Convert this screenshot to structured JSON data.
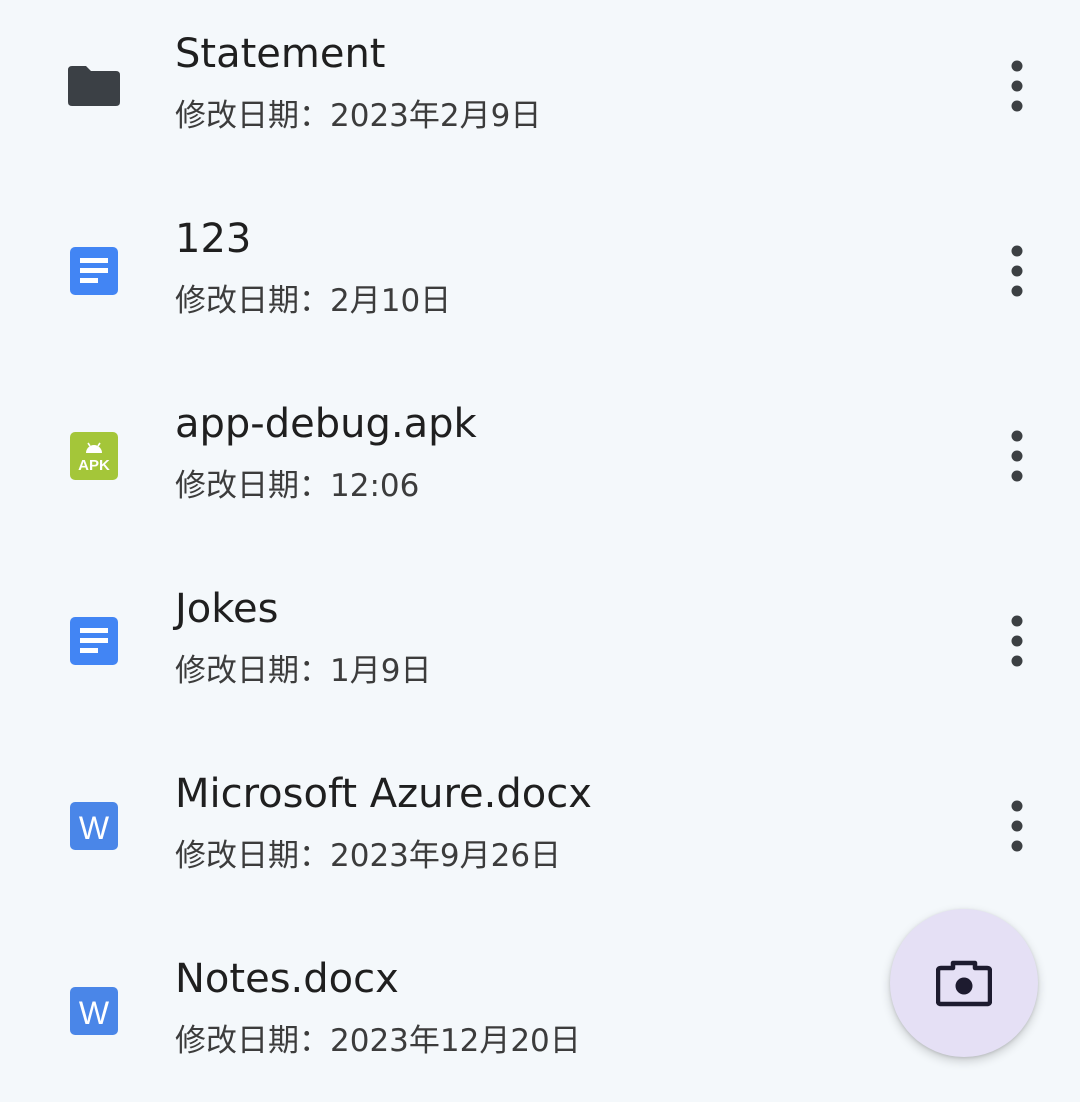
{
  "files": [
    {
      "name": "Statement",
      "modified": "修改日期：2023年2月9日",
      "icon": "folder-icon"
    },
    {
      "name": "123",
      "modified": "修改日期：2月10日",
      "icon": "google-doc-icon"
    },
    {
      "name": "app-debug.apk",
      "modified": "修改日期：12:06",
      "icon": "apk-icon",
      "icon_text": "APK"
    },
    {
      "name": "Jokes",
      "modified": "修改日期：1月9日",
      "icon": "google-doc-icon"
    },
    {
      "name": "Microsoft Azure.docx",
      "modified": "修改日期：2023年9月26日",
      "icon": "word-doc-icon",
      "icon_text": "W"
    },
    {
      "name": "Notes.docx",
      "modified": "修改日期：2023年12月20日",
      "icon": "word-doc-icon",
      "icon_text": "W"
    }
  ],
  "row_action_icon": "more-vert-icon",
  "fab": {
    "icon": "camera-icon"
  },
  "colors": {
    "background": "#f4f8fb",
    "folder": "#3b4045",
    "google_doc": "#4285f4",
    "apk": "#a4c639",
    "word": "#4a86e8",
    "fab_background": "#e5e0f5",
    "fab_icon": "#1d1b2f"
  }
}
